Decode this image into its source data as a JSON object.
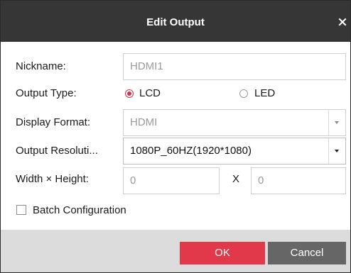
{
  "dialog": {
    "title": "Edit Output"
  },
  "form": {
    "nickname": {
      "label": "Nickname:",
      "value": "HDMI1"
    },
    "output_type": {
      "label": "Output Type:",
      "options": [
        {
          "label": "LCD",
          "selected": true
        },
        {
          "label": "LED",
          "selected": false
        }
      ]
    },
    "display_format": {
      "label": "Display Format:",
      "value": "HDMI"
    },
    "output_resolution": {
      "label": "Output Resoluti...",
      "value": "1080P_60HZ(1920*1080)"
    },
    "size": {
      "label": "Width × Height:",
      "width": "0",
      "separator": "X",
      "height": "0"
    },
    "batch": {
      "label": "Batch Configuration",
      "checked": false
    }
  },
  "footer": {
    "ok_label": "OK",
    "cancel_label": "Cancel"
  },
  "colors": {
    "title_bar": "#363636",
    "accent": "#e2394a",
    "cancel": "#666666",
    "footer": "#dcdcdc"
  }
}
